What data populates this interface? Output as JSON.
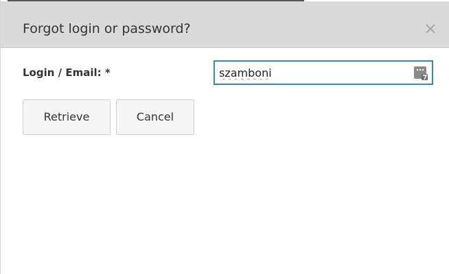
{
  "dialog": {
    "title": "Forgot login or password?",
    "close_icon": "close-icon"
  },
  "form": {
    "login_label": "Login / Email: *",
    "login_value": "szamboni",
    "field_icon": "contact-card-icon"
  },
  "buttons": {
    "retrieve": "Retrieve",
    "cancel": "Cancel"
  },
  "colors": {
    "header_bg": "#d9dadb",
    "input_border_focus": "#2f86c9",
    "spellcheck_underline": "#d94141"
  }
}
